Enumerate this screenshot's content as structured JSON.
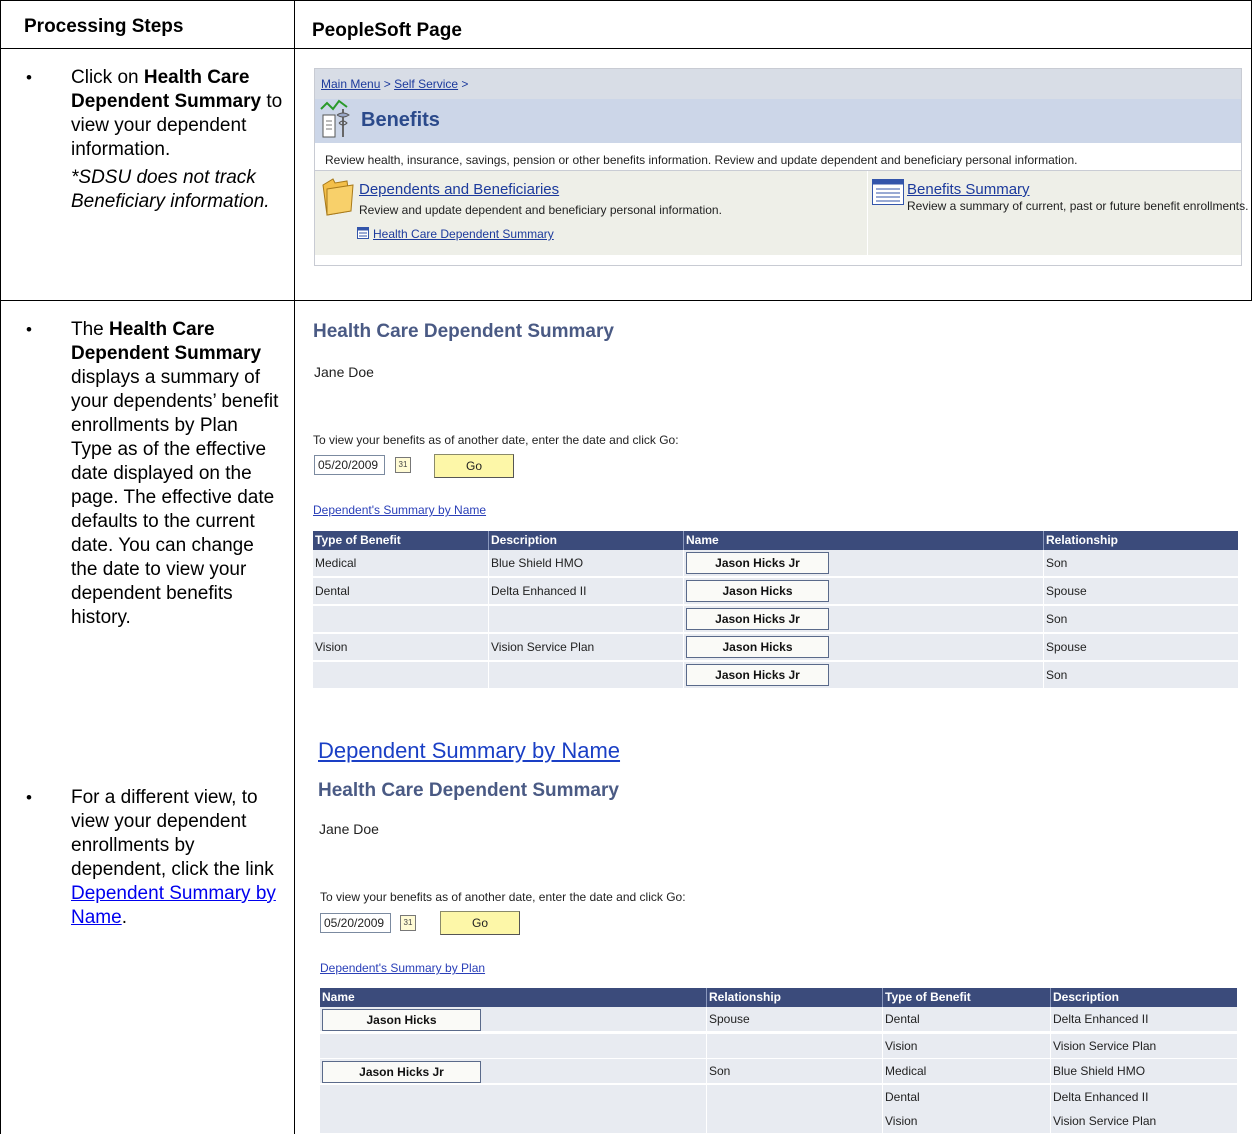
{
  "table": {
    "col1_header": "Processing Steps",
    "col2_header": "PeopleSoft Page"
  },
  "steps": {
    "s1_a": "Click on ",
    "s1_b": "Health Care Dependent Summary",
    "s1_c": " to view your dependent information.",
    "s1_note": "*SDSU does not track Beneficiary information.",
    "s2_a": "The ",
    "s2_b": "Health Care Dependent Summary",
    "s2_c": " displays a summary of your dependents’ benefit enrollments by Plan Type as of the effective date displayed on the page. The effective date defaults to the current date. You can change the date to view your dependent benefits history.",
    "s3_a": "For a different view, to view your dependent enrollments by dependent, click the link ",
    "s3_link": "Dependent Summary by Name",
    "s3_c": "."
  },
  "benefits_page": {
    "crumb_main": "Main Menu",
    "crumb_sep1": " > ",
    "crumb_self": "Self Service",
    "crumb_sep2": " >",
    "title": "Benefits",
    "description": "Review health, insurance, savings, pension or other benefits information. Review and update dependent and beneficiary personal information.",
    "dep_link": "Dependents and Beneficiaries",
    "dep_desc": "Review and update dependent and beneficiary personal information.",
    "hc_link": "Health Care Dependent Summary",
    "sum_link": "Benefits Summary",
    "sum_desc": "Review a summary of current, past or future benefit enrollments."
  },
  "summary_by_plan": {
    "title": "Health Care Dependent Summary",
    "employee": "Jane Doe",
    "instruction": "To view your benefits as of another date, enter the date and click Go:",
    "date": "05/20/2009",
    "go": "Go",
    "switch_link": "Dependent's Summary by Name",
    "headers": [
      "Type of Benefit",
      "Description",
      "Name",
      "Relationship"
    ],
    "rows": [
      {
        "type": "Medical",
        "desc": "Blue Shield HMO",
        "name": "Jason Hicks Jr",
        "rel": "Son"
      },
      {
        "type": "Dental",
        "desc": "Delta Enhanced II",
        "name": "Jason Hicks",
        "rel": "Spouse"
      },
      {
        "type": "",
        "desc": "",
        "name": "Jason Hicks Jr",
        "rel": "Son"
      },
      {
        "type": "Vision",
        "desc": "Vision Service Plan",
        "name": "Jason Hicks",
        "rel": "Spouse"
      },
      {
        "type": "",
        "desc": "",
        "name": "Jason Hicks Jr",
        "rel": "Son"
      }
    ]
  },
  "caption_link": "Dependent Summary by Name",
  "summary_by_name": {
    "title": "Health Care Dependent Summary",
    "employee": "Jane Doe",
    "instruction": "To view your benefits as of another date, enter the date and click Go:",
    "date": "05/20/2009",
    "go": "Go",
    "switch_link": "Dependent's Summary by Plan",
    "headers": [
      "Name",
      "Relationship",
      "Type of Benefit",
      "Description"
    ],
    "rows": [
      {
        "name": "Jason Hicks",
        "rel": "Spouse",
        "type": "Dental",
        "desc": "Delta Enhanced II"
      },
      {
        "name": "",
        "rel": "",
        "type": "Vision",
        "desc": "Vision Service Plan"
      },
      {
        "name": "Jason Hicks Jr",
        "rel": "Son",
        "type": "Medical",
        "desc": "Blue Shield HMO"
      },
      {
        "name": "",
        "rel": "",
        "type": "Dental",
        "desc": "Delta Enhanced II"
      },
      {
        "name": "",
        "rel": "",
        "type": "Vision",
        "desc": "Vision Service Plan"
      }
    ]
  }
}
